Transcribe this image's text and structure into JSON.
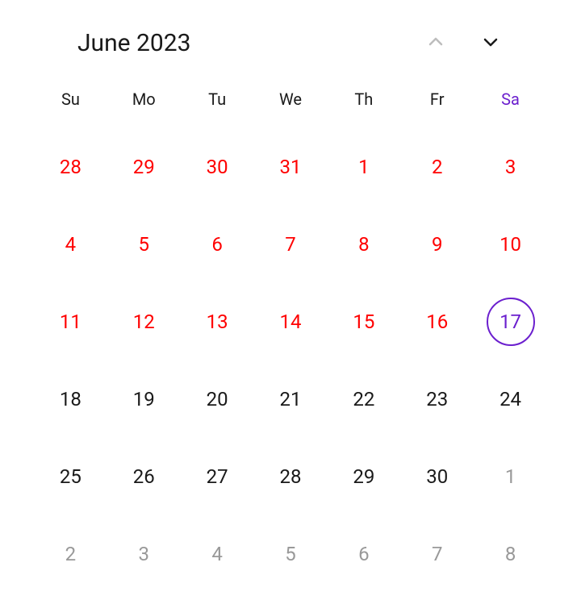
{
  "header": {
    "title": "June 2023"
  },
  "weekdays": [
    {
      "label": "Su",
      "accent": false
    },
    {
      "label": "Mo",
      "accent": false
    },
    {
      "label": "Tu",
      "accent": false
    },
    {
      "label": "We",
      "accent": false
    },
    {
      "label": "Th",
      "accent": false
    },
    {
      "label": "Fr",
      "accent": false
    },
    {
      "label": "Sa",
      "accent": true
    }
  ],
  "days": [
    {
      "num": "28",
      "state": "past"
    },
    {
      "num": "29",
      "state": "past"
    },
    {
      "num": "30",
      "state": "past"
    },
    {
      "num": "31",
      "state": "past"
    },
    {
      "num": "1",
      "state": "past"
    },
    {
      "num": "2",
      "state": "past"
    },
    {
      "num": "3",
      "state": "past"
    },
    {
      "num": "4",
      "state": "past"
    },
    {
      "num": "5",
      "state": "past"
    },
    {
      "num": "6",
      "state": "past"
    },
    {
      "num": "7",
      "state": "past"
    },
    {
      "num": "8",
      "state": "past"
    },
    {
      "num": "9",
      "state": "past"
    },
    {
      "num": "10",
      "state": "past"
    },
    {
      "num": "11",
      "state": "past"
    },
    {
      "num": "12",
      "state": "past"
    },
    {
      "num": "13",
      "state": "past"
    },
    {
      "num": "14",
      "state": "past"
    },
    {
      "num": "15",
      "state": "past"
    },
    {
      "num": "16",
      "state": "past"
    },
    {
      "num": "17",
      "state": "today"
    },
    {
      "num": "18",
      "state": "normal"
    },
    {
      "num": "19",
      "state": "normal"
    },
    {
      "num": "20",
      "state": "normal"
    },
    {
      "num": "21",
      "state": "normal"
    },
    {
      "num": "22",
      "state": "normal"
    },
    {
      "num": "23",
      "state": "normal"
    },
    {
      "num": "24",
      "state": "normal"
    },
    {
      "num": "25",
      "state": "normal"
    },
    {
      "num": "26",
      "state": "normal"
    },
    {
      "num": "27",
      "state": "normal"
    },
    {
      "num": "28",
      "state": "normal"
    },
    {
      "num": "29",
      "state": "normal"
    },
    {
      "num": "30",
      "state": "normal"
    },
    {
      "num": "1",
      "state": "other"
    },
    {
      "num": "2",
      "state": "other"
    },
    {
      "num": "3",
      "state": "other"
    },
    {
      "num": "4",
      "state": "other"
    },
    {
      "num": "5",
      "state": "other"
    },
    {
      "num": "6",
      "state": "other"
    },
    {
      "num": "7",
      "state": "other"
    },
    {
      "num": "8",
      "state": "other"
    }
  ],
  "colors": {
    "accent": "#6b1fce",
    "past": "#ff0000",
    "muted": "#999999",
    "text": "#1a1a1a"
  }
}
